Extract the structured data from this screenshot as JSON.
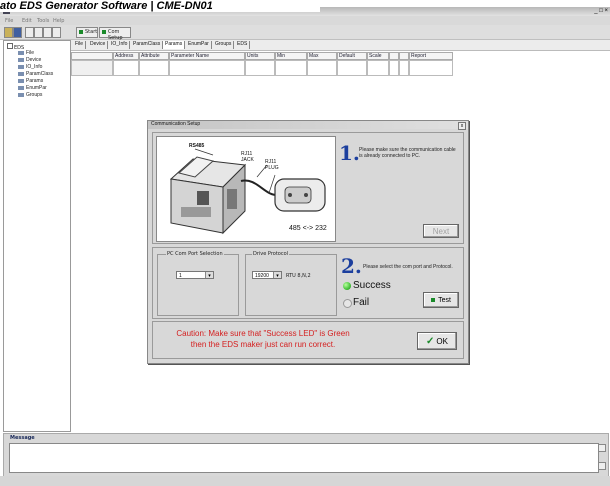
{
  "caption": "ato EDS Generator Software | CME-DN01",
  "app": {
    "window_controls": "_ □ ×",
    "menu": [
      "File",
      "Edit",
      "Tools",
      "Help"
    ]
  },
  "toolbar": {
    "start_label": "Start",
    "com_setup_label": "Com Setup"
  },
  "tree": {
    "root": "EDS",
    "items": [
      "File",
      "Device",
      "IO_Info",
      "ParamClass",
      "Params",
      "EnumPar",
      "Groups"
    ]
  },
  "tabs": [
    "File",
    "Device",
    "IO_Info",
    "ParamClass",
    "Params",
    "EnumPar",
    "Groups",
    "EDS"
  ],
  "columns": [
    "Address",
    "Attribute",
    "Parameter Name",
    "Units",
    "Min",
    "Max",
    "Default",
    "Scale",
    "",
    "",
    "Report"
  ],
  "dialog": {
    "title": "Communication Setup",
    "diagram_labels": {
      "rs485": "RS485",
      "rj11_jack": "RJ11 JACK",
      "rj11_plug": "RJ11 PLUG",
      "conversion": "485 <-> 232"
    },
    "step1": {
      "number": "1.",
      "text": "Please make sure the communication cable is already connected to PC."
    },
    "next_label": "Next",
    "com_port": {
      "legend": "PC Com Port Selection",
      "value": "1"
    },
    "drive_protocol": {
      "legend": "Drive Protocol",
      "value": "19200",
      "suffix": "RTU 8,N,2"
    },
    "step2": {
      "number": "2.",
      "text": "Please select the com port and Protocol."
    },
    "success_label": "Success",
    "fail_label": "Fail",
    "test_label": "Test",
    "caution_line1": "Caution: Make sure that \"Success LED\" is Green",
    "caution_line2": "then the EDS maker just can run correct.",
    "ok_label": "OK",
    "close_glyph": "x"
  },
  "message": {
    "label": "Message"
  },
  "colors": {
    "accent_blue": "#1c3f9e",
    "success_green": "#44c23a",
    "caution_red": "#d42020",
    "button_icon_green": "#1a8a2a"
  }
}
